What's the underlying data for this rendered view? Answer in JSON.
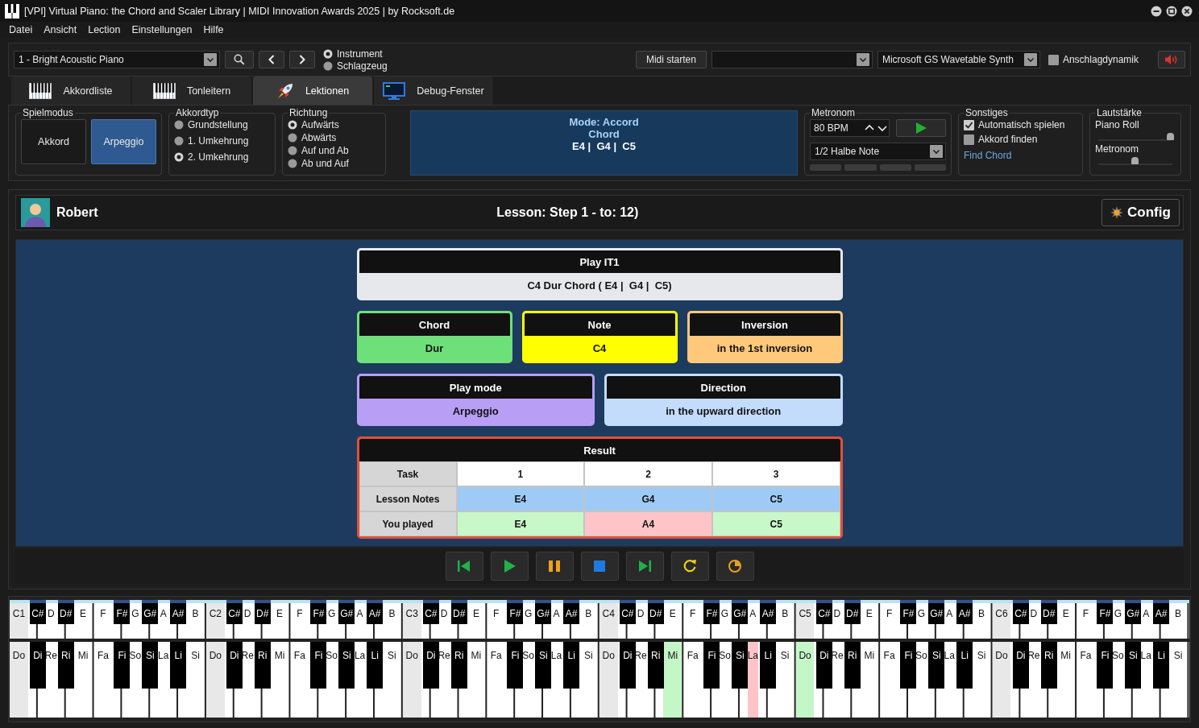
{
  "window": {
    "title": "[VPI] Virtual Piano: the Chord and Scaler Library | MIDI Innovation Awards 2025 | by Rocksoft.de"
  },
  "menu": [
    "Datei",
    "Ansicht",
    "Lection",
    "Einstellungen",
    "Hilfe"
  ],
  "toolbar": {
    "instrument": "1 - Bright Acoustic Piano",
    "sound_source": [
      {
        "label": "Instrument",
        "selected": true
      },
      {
        "label": "Schlagzeug",
        "selected": false
      }
    ],
    "midi_button": "Midi starten",
    "midi_device": "Microsoft GS Wavetable Synth",
    "velocity": {
      "label": "Anschlagdynamik",
      "checked": false
    }
  },
  "tabs": [
    {
      "label": "Akkordliste",
      "kind": "piano",
      "selected": false
    },
    {
      "label": "Tonleitern",
      "kind": "piano",
      "selected": false
    },
    {
      "label": "Lektionen",
      "kind": "rocket",
      "selected": true
    },
    {
      "label": "Debug-Fenster",
      "kind": "monitor",
      "selected": false
    }
  ],
  "play_mode": {
    "title": "Spielmodus",
    "options": [
      {
        "label": "Akkord",
        "selected": false
      },
      {
        "label": "Arpeggio",
        "selected": true
      }
    ]
  },
  "chord_type": {
    "title": "Akkordtyp",
    "options": [
      {
        "label": "Grundstellung",
        "selected": false
      },
      {
        "label": "1. Umkehrung",
        "selected": false
      },
      {
        "label": "2. Umkehrung",
        "selected": true
      }
    ]
  },
  "direction": {
    "title": "Richtung",
    "options": [
      {
        "label": "Aufwärts",
        "selected": true
      },
      {
        "label": "Abwärts",
        "selected": false
      },
      {
        "label": "Auf und Ab",
        "selected": false
      },
      {
        "label": "Ab und Auf",
        "selected": false
      }
    ]
  },
  "info": {
    "lines": [
      {
        "text": "Mode: Accord",
        "kind": "heading"
      },
      {
        "text": "Chord",
        "kind": "heading"
      },
      {
        "text": "E4 |  G4 |  C5",
        "kind": "notes"
      }
    ]
  },
  "metronome": {
    "title": "Metronom",
    "tempo": "80 BPM",
    "note_value": "1/2 Halbe Note",
    "beats": [
      {
        "active": false
      },
      {
        "active": false
      },
      {
        "active": false
      },
      {
        "active": false
      }
    ]
  },
  "other": {
    "title": "Sonstiges",
    "options": [
      {
        "label": "Automatisch spielen",
        "checked": true
      },
      {
        "label": "Akkord finden",
        "checked": false
      }
    ],
    "link": "Find Chord"
  },
  "volume": {
    "title": "Lautstärke",
    "sliders": [
      {
        "label": "Piano Roll",
        "level": 0.98
      },
      {
        "label": "Metronom",
        "level": 0.5
      }
    ]
  },
  "lesson": {
    "user": "Robert",
    "title": "Lesson: Step 1 - to: 12)",
    "config_button": "Config",
    "task": {
      "title": "Play IT1",
      "description": "C4 Dur Chord ( E4 |  G4 |  C5)"
    },
    "cards": [
      {
        "title": "Chord",
        "value": "Dur",
        "color": "#6ee07a"
      },
      {
        "title": "Note",
        "value": "C4",
        "color": "#ffff00"
      },
      {
        "title": "Inversion",
        "value": "in the 1st inversion",
        "color": "#ffc87a"
      }
    ],
    "cards_2": [
      {
        "title": "Play mode",
        "value": "Arpeggio",
        "color": "#b89ef5"
      },
      {
        "title": "Direction",
        "value": "in the upward direction",
        "color": "#c4dcfc"
      }
    ],
    "result": {
      "title": "Result",
      "columns_label": "Task",
      "columns": [
        "1",
        "2",
        "3"
      ],
      "expected_label": "Lesson Notes",
      "expected": [
        "E4",
        "G4",
        "C5"
      ],
      "played_label": "You played",
      "played": [
        {
          "note": "E4",
          "correct": true
        },
        {
          "note": "A4",
          "correct": false
        },
        {
          "note": "C5",
          "correct": true
        }
      ]
    }
  },
  "transport": [
    {
      "kind": "first"
    },
    {
      "kind": "play"
    },
    {
      "kind": "pause"
    },
    {
      "kind": "stop"
    },
    {
      "kind": "last"
    },
    {
      "kind": "repeat"
    },
    {
      "kind": "timer"
    }
  ],
  "keyboard": {
    "octaves": [
      {
        "keys": [
          {
            "note": "C1",
            "solfege": "Do",
            "highlight": false
          },
          {
            "note": "C#",
            "solfege": "Di",
            "highlight": false
          },
          {
            "note": "D",
            "solfege": "Re",
            "highlight": false
          },
          {
            "note": "D#",
            "solfege": "Ri",
            "highlight": false
          },
          {
            "note": "E",
            "solfege": "Mi",
            "highlight": false
          },
          {
            "note": "F",
            "solfege": "Fa",
            "highlight": false
          },
          {
            "note": "F#",
            "solfege": "Fi",
            "highlight": false
          },
          {
            "note": "G",
            "solfege": "So",
            "highlight": false
          },
          {
            "note": "G#",
            "solfege": "Si",
            "highlight": false
          },
          {
            "note": "A",
            "solfege": "La",
            "highlight": false
          },
          {
            "note": "A#",
            "solfege": "Li",
            "highlight": false
          },
          {
            "note": "B",
            "solfege": "Si",
            "highlight": false
          }
        ]
      },
      {
        "keys": [
          {
            "note": "C2",
            "solfege": "Do",
            "highlight": false
          },
          {
            "note": "C#",
            "solfege": "Di",
            "highlight": false
          },
          {
            "note": "D",
            "solfege": "Re",
            "highlight": false
          },
          {
            "note": "D#",
            "solfege": "Ri",
            "highlight": false
          },
          {
            "note": "E",
            "solfege": "Mi",
            "highlight": false
          },
          {
            "note": "F",
            "solfege": "Fa",
            "highlight": false
          },
          {
            "note": "F#",
            "solfege": "Fi",
            "highlight": false
          },
          {
            "note": "G",
            "solfege": "So",
            "highlight": false
          },
          {
            "note": "G#",
            "solfege": "Si",
            "highlight": false
          },
          {
            "note": "A",
            "solfege": "La",
            "highlight": false
          },
          {
            "note": "A#",
            "solfege": "Li",
            "highlight": false
          },
          {
            "note": "B",
            "solfege": "Si",
            "highlight": false
          }
        ]
      },
      {
        "keys": [
          {
            "note": "C3",
            "solfege": "Do",
            "highlight": false
          },
          {
            "note": "C#",
            "solfege": "Di",
            "highlight": false
          },
          {
            "note": "D",
            "solfege": "Re",
            "highlight": false
          },
          {
            "note": "D#",
            "solfege": "Ri",
            "highlight": false
          },
          {
            "note": "E",
            "solfege": "Mi",
            "highlight": false
          },
          {
            "note": "F",
            "solfege": "Fa",
            "highlight": false
          },
          {
            "note": "F#",
            "solfege": "Fi",
            "highlight": false
          },
          {
            "note": "G",
            "solfege": "So",
            "highlight": false
          },
          {
            "note": "G#",
            "solfege": "Si",
            "highlight": false
          },
          {
            "note": "A",
            "solfege": "La",
            "highlight": false
          },
          {
            "note": "A#",
            "solfege": "Li",
            "highlight": false
          },
          {
            "note": "B",
            "solfege": "Si",
            "highlight": false
          }
        ]
      },
      {
        "keys": [
          {
            "note": "C4",
            "solfege": "Do",
            "highlight": false
          },
          {
            "note": "C#",
            "solfege": "Di",
            "highlight": false
          },
          {
            "note": "D",
            "solfege": "Re",
            "highlight": false
          },
          {
            "note": "D#",
            "solfege": "Ri",
            "highlight": false
          },
          {
            "note": "E",
            "solfege": "Mi",
            "highlight": true,
            "color": "#c4f7c8"
          },
          {
            "note": "F",
            "solfege": "Fa",
            "highlight": false
          },
          {
            "note": "F#",
            "solfege": "Fi",
            "highlight": false
          },
          {
            "note": "G",
            "solfege": "So",
            "highlight": false
          },
          {
            "note": "G#",
            "solfege": "Si",
            "highlight": false
          },
          {
            "note": "A",
            "solfege": "La",
            "highlight": true,
            "color": "#ffc4c8"
          },
          {
            "note": "A#",
            "solfege": "Li",
            "highlight": false
          },
          {
            "note": "B",
            "solfege": "Si",
            "highlight": false
          }
        ]
      },
      {
        "keys": [
          {
            "note": "C5",
            "solfege": "Do",
            "highlight": true,
            "color": "#c4f7c8"
          },
          {
            "note": "C#",
            "solfege": "Di",
            "highlight": false
          },
          {
            "note": "D",
            "solfege": "Re",
            "highlight": false
          },
          {
            "note": "D#",
            "solfege": "Ri",
            "highlight": false
          },
          {
            "note": "E",
            "solfege": "Mi",
            "highlight": false
          },
          {
            "note": "F",
            "solfege": "Fa",
            "highlight": false
          },
          {
            "note": "F#",
            "solfege": "Fi",
            "highlight": false
          },
          {
            "note": "G",
            "solfege": "So",
            "highlight": false
          },
          {
            "note": "G#",
            "solfege": "Si",
            "highlight": false
          },
          {
            "note": "A",
            "solfege": "La",
            "highlight": false
          },
          {
            "note": "A#",
            "solfege": "Li",
            "highlight": false
          },
          {
            "note": "B",
            "solfege": "Si",
            "highlight": false
          }
        ]
      },
      {
        "keys": [
          {
            "note": "C6",
            "solfege": "Do",
            "highlight": false
          },
          {
            "note": "C#",
            "solfege": "Di",
            "highlight": false
          },
          {
            "note": "D",
            "solfege": "Re",
            "highlight": false
          },
          {
            "note": "D#",
            "solfege": "Ri",
            "highlight": false
          },
          {
            "note": "E",
            "solfege": "Mi",
            "highlight": false
          },
          {
            "note": "F",
            "solfege": "Fa",
            "highlight": false
          },
          {
            "note": "F#",
            "solfege": "Fi",
            "highlight": false
          },
          {
            "note": "G",
            "solfege": "So",
            "highlight": false
          },
          {
            "note": "G#",
            "solfege": "Si",
            "highlight": false
          },
          {
            "note": "A",
            "solfege": "La",
            "highlight": false
          },
          {
            "note": "A#",
            "solfege": "Li",
            "highlight": false
          },
          {
            "note": "B",
            "solfege": "Si",
            "highlight": false
          }
        ]
      }
    ]
  }
}
